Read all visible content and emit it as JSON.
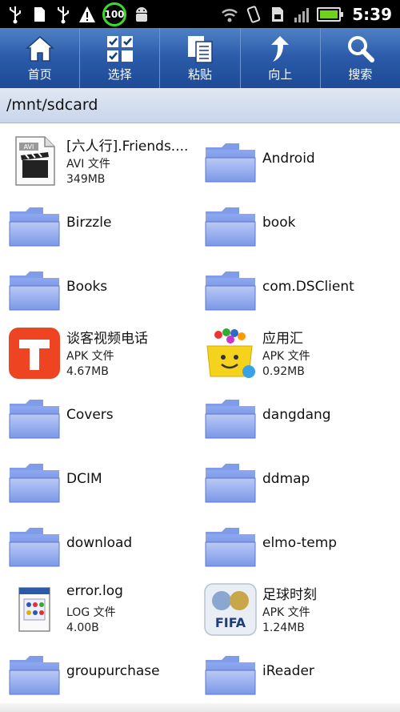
{
  "status_bar": {
    "battery_badge": "100",
    "time": "5:39",
    "battery_level": 1.0
  },
  "toolbar": {
    "buttons": [
      {
        "label": "首页",
        "icon": "home-icon"
      },
      {
        "label": "选择",
        "icon": "select-checklist-icon"
      },
      {
        "label": "粘贴",
        "icon": "paste-icon"
      },
      {
        "label": "向上",
        "icon": "up-arrow-icon"
      },
      {
        "label": "搜索",
        "icon": "search-icon"
      }
    ]
  },
  "path": "/mnt/sdcard",
  "files": [
    {
      "name": "[六人行].Friends....",
      "type": "AVI 文件",
      "size": "349MB",
      "icon": "avi-file-icon"
    },
    {
      "name": "Android",
      "icon": "folder-icon"
    },
    {
      "name": "Birzzle",
      "icon": "folder-icon"
    },
    {
      "name": "book",
      "icon": "folder-icon"
    },
    {
      "name": "Books",
      "icon": "folder-icon"
    },
    {
      "name": "com.DSClient",
      "icon": "folder-icon"
    },
    {
      "name": "谈客视频电话",
      "type": "APK 文件",
      "size": "4.67MB",
      "icon": "tango-app-icon"
    },
    {
      "name": " 应用汇",
      "type": "APK 文件",
      "size": "0.92MB",
      "icon": "appchina-app-icon"
    },
    {
      "name": "Covers",
      "icon": "folder-icon"
    },
    {
      "name": "dangdang",
      "icon": "folder-icon"
    },
    {
      "name": "DCIM",
      "icon": "folder-icon"
    },
    {
      "name": "ddmap",
      "icon": "folder-icon"
    },
    {
      "name": "download",
      "icon": "folder-icon"
    },
    {
      "name": "elmo-temp",
      "icon": "folder-icon"
    },
    {
      "name": "error.log",
      "type": "LOG 文件",
      "size": "4.00B",
      "icon": "log-file-icon"
    },
    {
      "name": "足球时刻",
      "type": "APK 文件",
      "size": "1.24MB",
      "icon": "fifa-app-icon"
    },
    {
      "name": "groupurchase",
      "icon": "folder-icon"
    },
    {
      "name": "iReader",
      "icon": "folder-icon"
    }
  ],
  "fifa_logo_text": "FIFA",
  "colors": {
    "toolbar": "#2a5aa8",
    "folder": "#6f8fe0",
    "battery_badge_ring": "#3adb29",
    "battery_fill": "#6fd31c"
  }
}
